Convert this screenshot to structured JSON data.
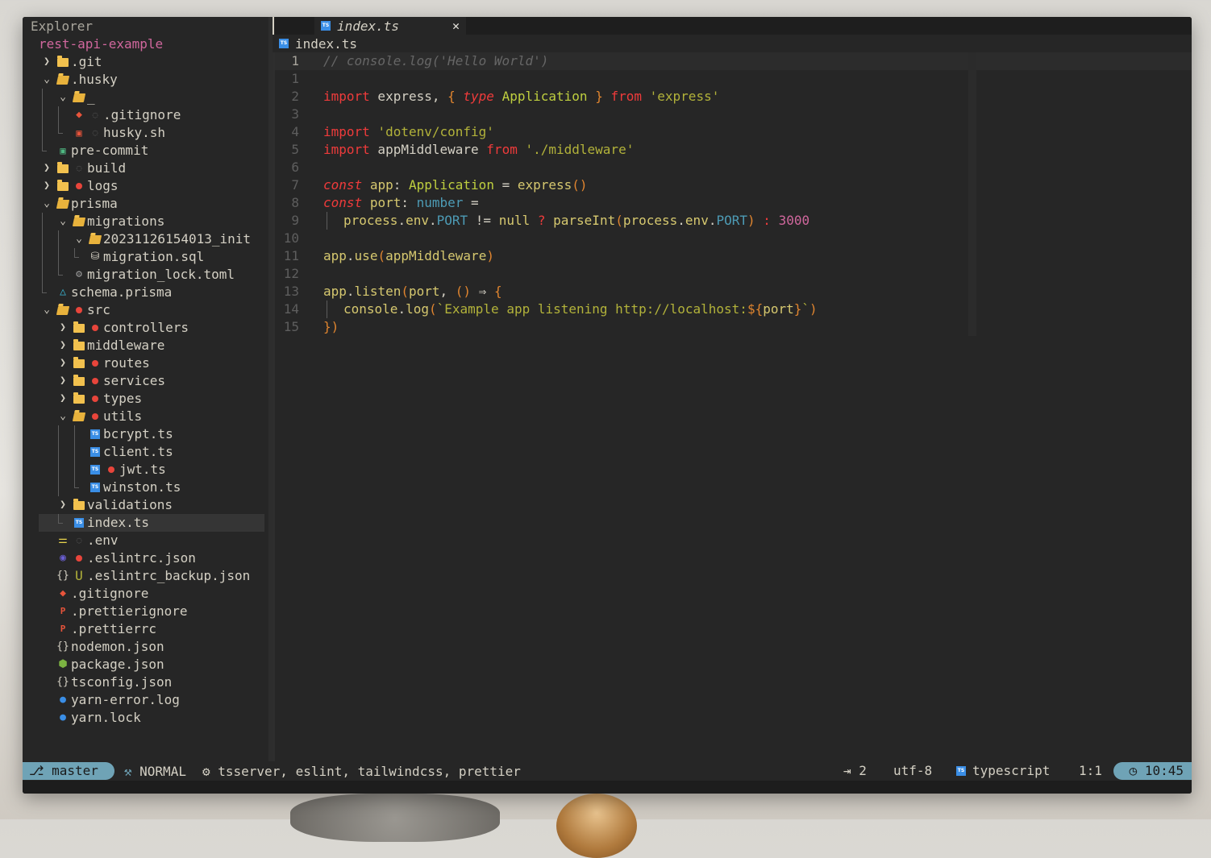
{
  "explorer": {
    "title": "Explorer",
    "project": "rest-api-example",
    "items": [
      {
        "label": ".git"
      },
      {
        "label": ".husky"
      },
      {
        "label": "_"
      },
      {
        "label": ".gitignore"
      },
      {
        "label": "husky.sh"
      },
      {
        "label": "pre-commit"
      },
      {
        "label": "build"
      },
      {
        "label": "logs"
      },
      {
        "label": "prisma"
      },
      {
        "label": "migrations"
      },
      {
        "label": "20231126154013_init"
      },
      {
        "label": "migration.sql"
      },
      {
        "label": "migration_lock.toml"
      },
      {
        "label": "schema.prisma"
      },
      {
        "label": "src"
      },
      {
        "label": "controllers"
      },
      {
        "label": "middleware"
      },
      {
        "label": "routes"
      },
      {
        "label": "services"
      },
      {
        "label": "types"
      },
      {
        "label": "utils"
      },
      {
        "label": "bcrypt.ts"
      },
      {
        "label": "client.ts"
      },
      {
        "label": "jwt.ts"
      },
      {
        "label": "winston.ts"
      },
      {
        "label": "validations"
      },
      {
        "label": "index.ts"
      },
      {
        "label": ".env"
      },
      {
        "label": ".eslintrc.json"
      },
      {
        "label": ".eslintrc_backup.json",
        "status": "U"
      },
      {
        "label": ".gitignore"
      },
      {
        "label": ".prettierignore"
      },
      {
        "label": ".prettierrc"
      },
      {
        "label": "nodemon.json"
      },
      {
        "label": "package.json"
      },
      {
        "label": "tsconfig.json"
      },
      {
        "label": "yarn-error.log"
      },
      {
        "label": "yarn.lock"
      }
    ]
  },
  "tab": {
    "label": "index.ts",
    "close": "✕"
  },
  "breadcrumb": "index.ts",
  "code": {
    "lines": [
      "1",
      "1",
      "2",
      "3",
      "4",
      "5",
      "6",
      "7",
      "8",
      "9",
      "10",
      "11",
      "12",
      "13",
      "14",
      "15"
    ]
  },
  "status": {
    "branch": "master",
    "mode": "NORMAL",
    "lsp": "tsserver, eslint, tailwindcss, prettier",
    "indent": "2",
    "encoding": "utf-8",
    "filetype": "typescript",
    "position": "1:1",
    "time": "10:45"
  },
  "colors": {
    "accent": "#6fa3b6",
    "keyword": "#ef3b3b",
    "string": "#b2b23a",
    "modified": "#e8453b",
    "project": "#d0679d"
  }
}
